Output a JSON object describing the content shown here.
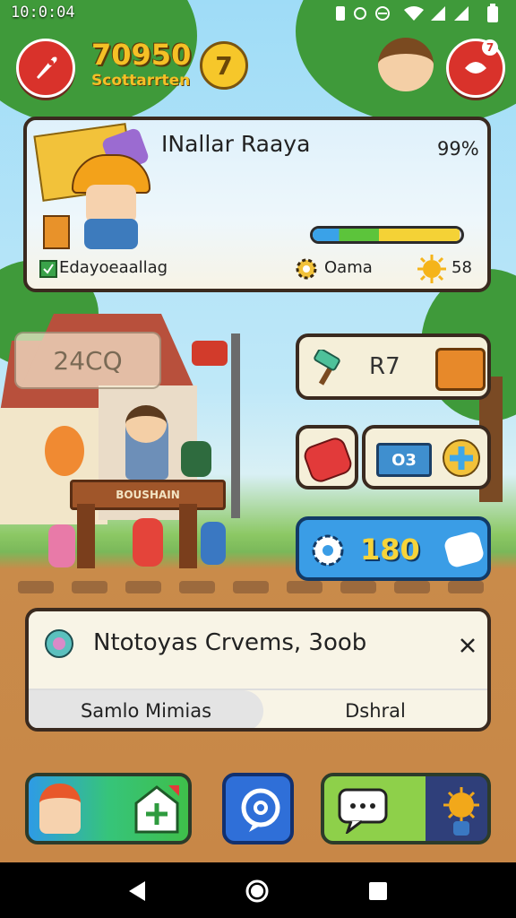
{
  "status_bar": {
    "time": "10:0:04"
  },
  "top_bar": {
    "coins": "70950",
    "coins_sub": "Scottarrten",
    "coin_badge": "7",
    "notif_count": "7"
  },
  "profile": {
    "name": "INallar Raaya",
    "progress_label": "99%",
    "progress_value": 0.99,
    "stat1": "Edayoeaallag",
    "stat2": "Oama",
    "stat3": "58"
  },
  "scene": {
    "sign_value": "24CQ",
    "stand_sign": "BOUSHAIN"
  },
  "panels": {
    "tool_count": "R7",
    "ticket_label": "O3",
    "gems_count": "180"
  },
  "notification": {
    "title": "Ntotoyas Crvems, 3oob",
    "tab_left": "Samlo Mimias",
    "tab_right": "Dshral"
  },
  "colors": {
    "accent_red": "#d9322b",
    "gold": "#f5c026",
    "panel_border": "#3a2a1f",
    "gems_blue": "#2d8fe0"
  }
}
